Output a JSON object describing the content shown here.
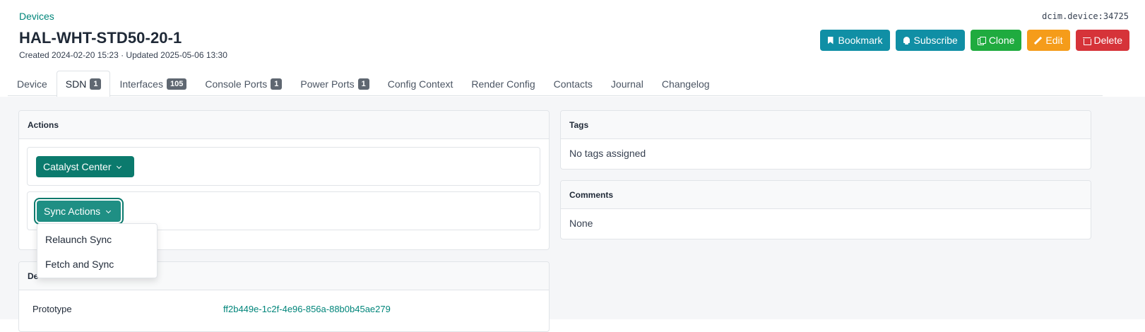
{
  "breadcrumb": {
    "label": "Devices"
  },
  "object_id": "dcim.device:34725",
  "title": "HAL-WHT-STD50-20-1",
  "meta": "Created 2024-02-20 15:23 · Updated 2025-05-06 13:30",
  "buttons": {
    "bookmark": "Bookmark",
    "subscribe": "Subscribe",
    "clone": "Clone",
    "edit": "Edit",
    "delete": "Delete"
  },
  "tabs": [
    {
      "label": "Device"
    },
    {
      "label": "SDN",
      "badge": "1",
      "active": true
    },
    {
      "label": "Interfaces",
      "badge": "105"
    },
    {
      "label": "Console Ports",
      "badge": "1"
    },
    {
      "label": "Power Ports",
      "badge": "1"
    },
    {
      "label": "Config Context"
    },
    {
      "label": "Render Config"
    },
    {
      "label": "Contacts"
    },
    {
      "label": "Journal"
    },
    {
      "label": "Changelog"
    }
  ],
  "actions_card": {
    "header": "Actions",
    "catalyst_button": "Catalyst Center",
    "sync_button": "Sync Actions",
    "sync_menu": [
      "Relaunch Sync",
      "Fetch and Sync"
    ]
  },
  "device_card": {
    "header_partial": "De",
    "header_partial_tail": "e",
    "row_label": "Prototype",
    "row_value": "ff2b449e-1c2f-4e96-856a-88b0b45ae279"
  },
  "tags_card": {
    "header": "Tags",
    "body": "No tags assigned"
  },
  "comments_card": {
    "header": "Comments",
    "body": "None"
  },
  "colors": {
    "teal": "#108fa5",
    "green": "#1fab3f",
    "orange": "#f59c1a",
    "red": "#d63339",
    "primary": "#0b7a6d"
  }
}
